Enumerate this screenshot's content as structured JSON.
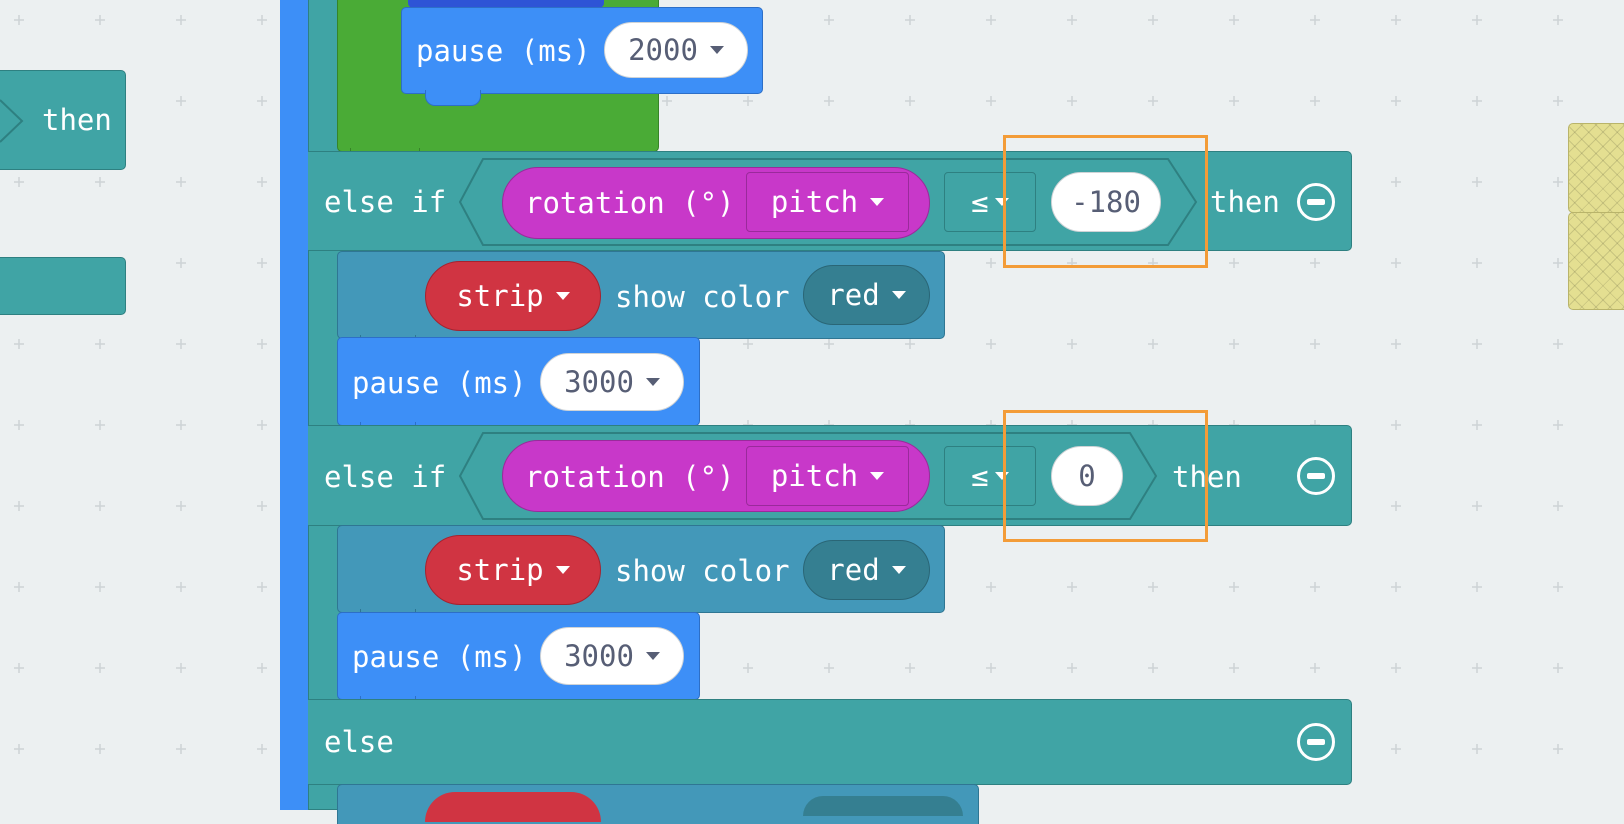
{
  "blocks": {
    "left_then": "then",
    "pause_label": "pause (ms)",
    "pause_top_value": "2000",
    "else_if_label": "else if",
    "then_label": "then",
    "else_label": "else",
    "rotation_label": "rotation (°)",
    "pitch_option": "pitch",
    "compare_op": "≤",
    "compare_value_1": "-180",
    "compare_value_2": "0",
    "strip_label": "strip",
    "show_color_label": "show color",
    "color_value": "red",
    "pause_value_1": "3000",
    "pause_value_2": "3000"
  },
  "colors": {
    "logic_teal": "#40a4a5",
    "loops_green": "#4aab36",
    "basic_blue": "#3d8ff7",
    "neopixel_steel": "#4398b9",
    "input_magenta": "#c838c9",
    "strip_red": "#d03442",
    "highlight_orange": "#f39c38",
    "workspace_bg": "#ecf0f1"
  }
}
